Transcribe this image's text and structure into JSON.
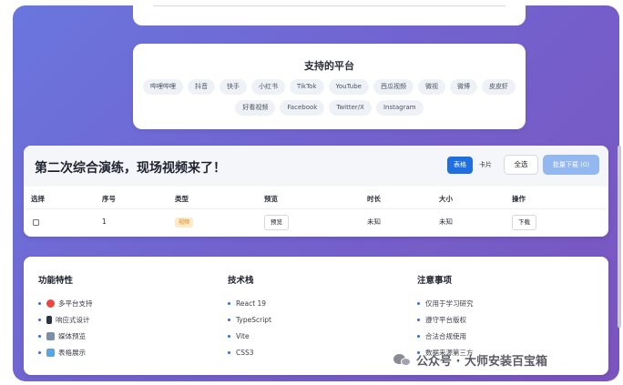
{
  "platforms": {
    "title": "支持的平台",
    "row1": [
      "哔哩哔哩",
      "抖音",
      "快手",
      "小红书",
      "TikTok",
      "YouTube",
      "西瓜视频",
      "微视",
      "微博",
      "皮皮虾"
    ],
    "row2": [
      "好看视频",
      "Facebook",
      "Twitter/X",
      "Instagram"
    ]
  },
  "main": {
    "title": "第二次综合演练，现场视频来了！",
    "view_table": "表格",
    "view_card": "卡片",
    "select_all": "全选",
    "batch_download": "批量下载 (0)",
    "columns": [
      "选择",
      "序号",
      "类型",
      "预览",
      "时长",
      "大小",
      "操作"
    ],
    "rows": [
      {
        "index": "1",
        "type": "视频",
        "preview": "预览",
        "duration": "未知",
        "size": "未知",
        "action": "下载"
      }
    ]
  },
  "features": {
    "col1": {
      "title": "功能特性",
      "items": [
        "多平台支持",
        "响应式设计",
        "媒体预览",
        "表格展示"
      ]
    },
    "col2": {
      "title": "技术栈",
      "items": [
        "React 19",
        "TypeScript",
        "Vite",
        "CSS3"
      ]
    },
    "col3": {
      "title": "注意事项",
      "items": [
        "仅用于学习研究",
        "遵守平台版权",
        "合法合规使用",
        "数据来源第三方"
      ]
    }
  },
  "watermark": {
    "text": "公众号 · 大师安装百宝箱"
  },
  "colors": {
    "accent": "#1f6fe0",
    "batch_disabled": "#93b7ef",
    "badge_bg": "#fdebc8",
    "badge_text": "#d88a1b"
  }
}
